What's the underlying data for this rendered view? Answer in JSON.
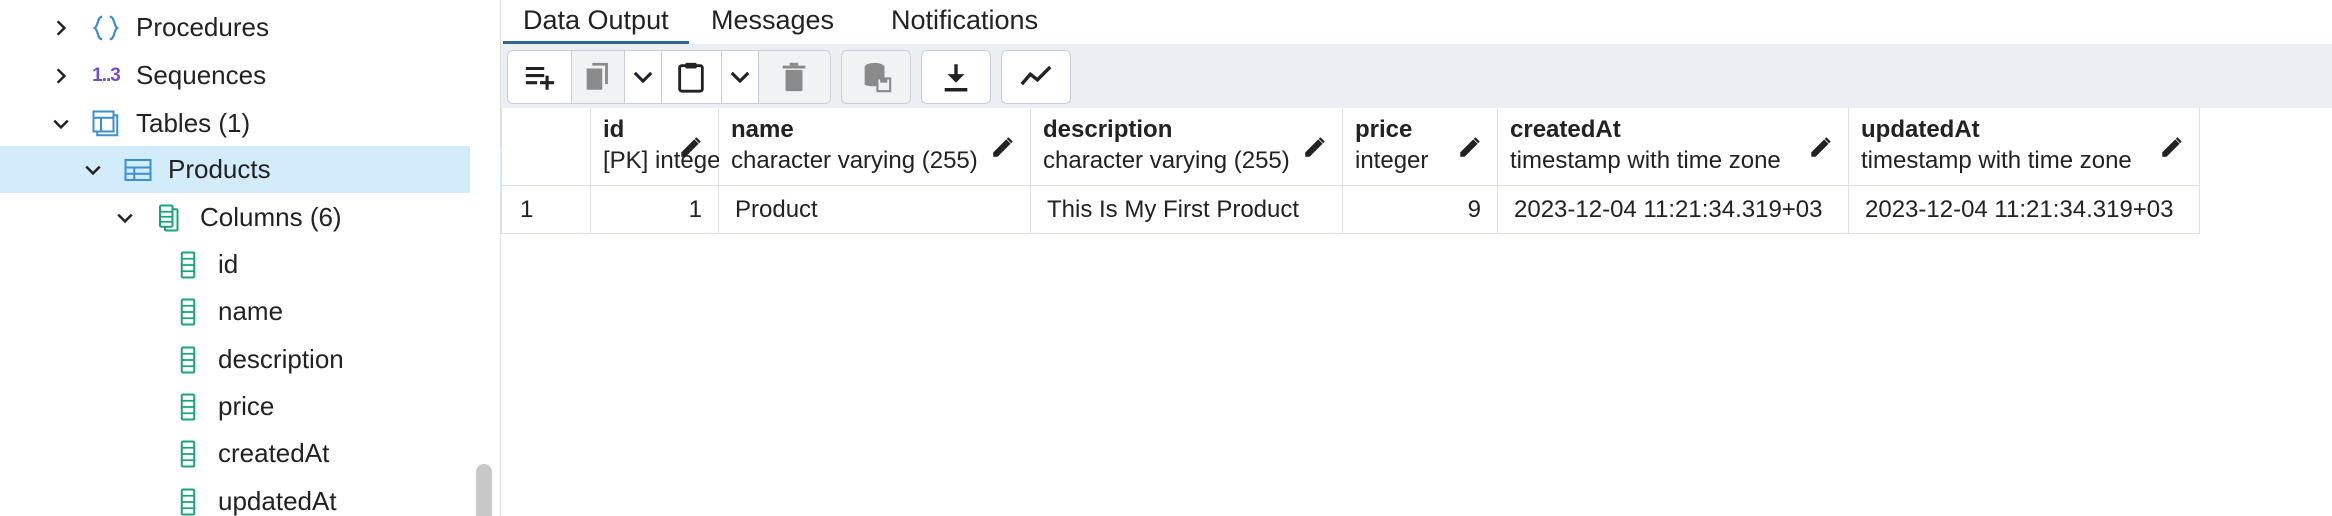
{
  "tree": {
    "items": [
      {
        "label": "Procedures",
        "icon": "procedure-icon",
        "chevron": "right"
      },
      {
        "label": "Sequences",
        "icon": "sequence-icon",
        "icon_text": "1..3",
        "chevron": "right"
      },
      {
        "label": "Tables (1)",
        "icon": "tables-icon",
        "chevron": "down"
      },
      {
        "label": "Products",
        "icon": "table-icon",
        "chevron": "down",
        "selected": true
      },
      {
        "label": "Columns (6)",
        "icon": "columns-icon",
        "chevron": "down"
      },
      {
        "label": "id",
        "icon": "column-icon"
      },
      {
        "label": "name",
        "icon": "column-icon"
      },
      {
        "label": "description",
        "icon": "column-icon"
      },
      {
        "label": "price",
        "icon": "column-icon"
      },
      {
        "label": "createdAt",
        "icon": "column-icon"
      },
      {
        "label": "updatedAt",
        "icon": "column-icon"
      }
    ]
  },
  "tabs": [
    {
      "label": "Data Output",
      "active": true
    },
    {
      "label": "Messages"
    },
    {
      "label": "Notifications"
    }
  ],
  "toolbar": {
    "buttons": [
      "add-row-icon",
      "copy-icon",
      "chevron-down-icon",
      "paste-icon",
      "chevron-down-icon",
      "delete-icon",
      "save-data-icon",
      "download-icon",
      "graph-icon"
    ]
  },
  "grid": {
    "columns": [
      {
        "name": "id",
        "type": "[PK] integer"
      },
      {
        "name": "name",
        "type": "character varying (255)"
      },
      {
        "name": "description",
        "type": "character varying (255)"
      },
      {
        "name": "price",
        "type": "integer"
      },
      {
        "name": "createdAt",
        "type": "timestamp with time zone"
      },
      {
        "name": "updatedAt",
        "type": "timestamp with time zone"
      }
    ],
    "rows": [
      {
        "row_number": "1",
        "cells": [
          "1",
          "Product",
          "This Is My First Product",
          "9",
          "2023-12-04 11:21:34.319+03",
          "2023-12-04 11:21:34.319+03"
        ]
      }
    ]
  },
  "colors": {
    "accent": "#326690",
    "selected_bg": "#d3ecfb",
    "toolbar_bg": "#ebeef3",
    "column_icon": "#1aa37a",
    "sequence_icon": "#7a4dc4",
    "procedure_icon": "#3a8fd0"
  }
}
